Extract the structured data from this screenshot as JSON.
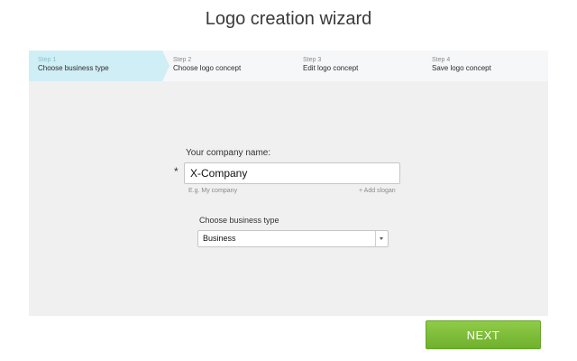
{
  "page": {
    "title": "Logo creation wizard"
  },
  "steps": [
    {
      "num": "Step 1",
      "label": "Choose business type",
      "active": true
    },
    {
      "num": "Step 2",
      "label": "Choose logo concept",
      "active": false
    },
    {
      "num": "Step 3",
      "label": "Edit logo concept",
      "active": false
    },
    {
      "num": "Step 4",
      "label": "Save logo concept",
      "active": false
    }
  ],
  "form": {
    "company_label": "Your company name:",
    "required_mark": "*",
    "company_value": "X-Company",
    "company_hint": "E.g. My company",
    "add_slogan": "+ Add slogan",
    "business_type_label": "Choose business type",
    "business_type_value": "Business"
  },
  "actions": {
    "next_label": "NEXT"
  },
  "colors": {
    "active_step": "#cfeef6",
    "next_button": "#7dbd3a",
    "panel": "#f0f0f0"
  }
}
